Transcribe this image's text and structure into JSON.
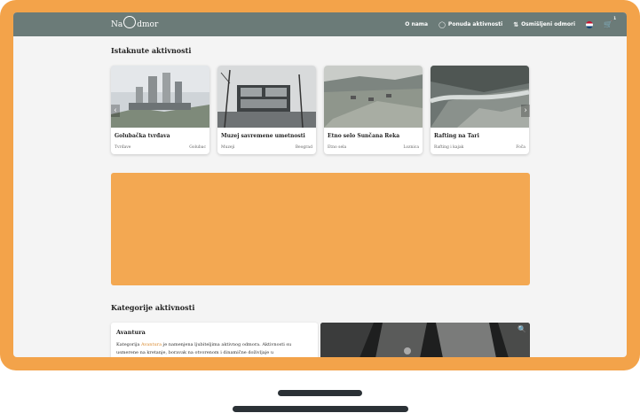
{
  "header": {
    "logo_part1": "Na",
    "logo_part2": "dmor",
    "nav": [
      {
        "label": "O nama",
        "icon": ""
      },
      {
        "label": "Ponuda aktivnosti",
        "icon": "tag-icon"
      },
      {
        "label": "Osmišljeni odmori",
        "icon": "sort-icon"
      }
    ],
    "cart_count": "1"
  },
  "featured": {
    "title": "Istaknute aktivnosti",
    "cards": [
      {
        "title": "Golubačka tvrđava",
        "category": "Tvrđave",
        "location": "Golubac"
      },
      {
        "title": "Muzej savremene umetnosti",
        "category": "Muzeji",
        "location": "Beograd"
      },
      {
        "title": "Etno selo Sunčana Reka",
        "category": "Etno sela",
        "location": "Loznica"
      },
      {
        "title": "Rafting na Tari",
        "category": "Rafting i kajak",
        "location": "Foča"
      }
    ]
  },
  "categories": {
    "title": "Kategorije aktivnosti",
    "first": {
      "title": "Avantura",
      "desc_prefix": "Kategorija ",
      "desc_link": "Avantura",
      "desc_rest": " je namenjena ljubiteljima aktivnog odmora. Aktivnosti su usmerene na kretanje, boravak na otvorenom i dinamične doživljaje u"
    }
  },
  "colors": {
    "frame": "#f3a34a",
    "header": "#6b7b78",
    "banner": "#f3a852",
    "link": "#d98a2f"
  }
}
